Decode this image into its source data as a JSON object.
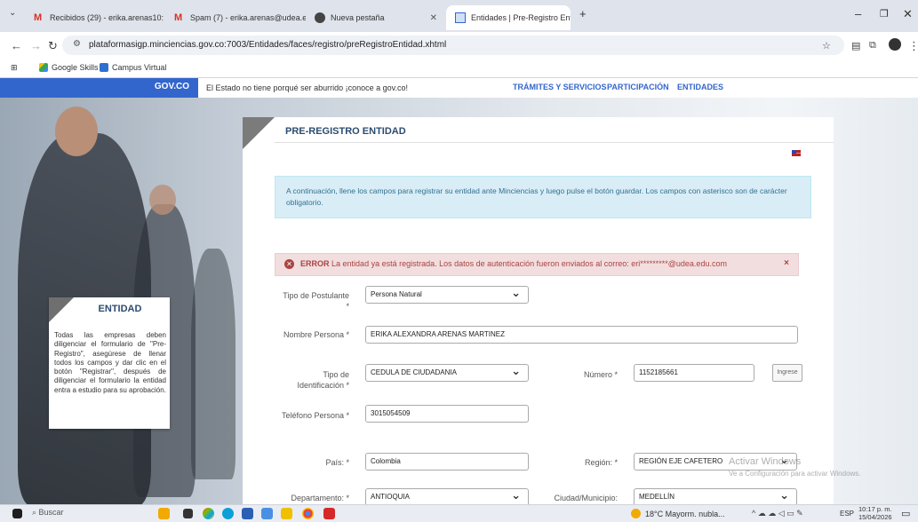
{
  "browser": {
    "tabs": [
      {
        "label": "Recibidos (29) - erika.arenas10:",
        "color": "#d93025"
      },
      {
        "label": "Spam (7) - erika.arenas@udea.e",
        "color": "#d93025"
      },
      {
        "label": "Nueva pestaña",
        "color": "#444444"
      },
      {
        "label": "Entidades | Pre-Registro Entida",
        "color": "#3366cc"
      }
    ],
    "new_tab": "+",
    "url": "plataformasigp.minciencias.gov.co:7003/Entidades/faces/registro/preRegistroEntidad.xhtml",
    "bookmarks": [
      "Google Skills",
      "Campus Virtual"
    ]
  },
  "gov": {
    "logo": "GOV.CO",
    "message": "El Estado no tiene porqué ser aburrido ¡conoce a gov.co!",
    "links": [
      "TRÁMITES Y SERVICIOS",
      "PARTICIPACIÓN",
      "ENTIDADES"
    ]
  },
  "sidebar": {
    "title": "ENTIDAD",
    "text": "Todas las empresas deben diligenciar el formulario de \"Pre-Registro\", asegúrese de llenar todos los campos y dar clic en el botón \"Registrar\", después de diligenciar el formulario la entidad entra a estudio para su aprobación."
  },
  "form": {
    "title": "PRE-REGISTRO ENTIDAD",
    "info": "A continuación, llene los campos para registrar su entidad ante Minciencias y luego pulse el botón guardar. Los campos con asterisco son de carácter obligatorio.",
    "error_label": "ERROR",
    "error_text": "La entidad ya está registrada. Los datos de autenticación fueron enviados al correo: eri*********@udea.edu.com",
    "error_close": "×",
    "tipo_postulante_label": "Tipo de Postulante *",
    "tipo_postulante": "Persona Natural",
    "nombre_label": "Nombre Persona *",
    "nombre": "ERIKA ALEXANDRA ARENAS MARTINEZ",
    "tipo_id_label": "Tipo de Identificación *",
    "tipo_id": "CEDULA DE CIUDADANIA",
    "numero_label": "Número *",
    "numero": "1152185661",
    "ingrese": "Ingrese",
    "telefono_label": "Teléfono Persona *",
    "telefono": "3015054509",
    "pais_label": "País: *",
    "pais": "Colombia",
    "region_label": "Región: *",
    "region": "REGIÓN EJE CAFETERO",
    "depto_label": "Departamento: *",
    "depto": "ANTIOQUIA",
    "ciudad_label": "Ciudad/Municipio:",
    "ciudad": "MEDELLÍN"
  },
  "watermark": {
    "line1": "Activar Windows",
    "line2": "Ve a Configuración para activar Windows."
  },
  "taskbar": {
    "search": "Buscar",
    "weather": "18°C Mayorm. nubla...",
    "lang": "ESP",
    "time": "10:17 p. m.",
    "date": "15/04/2026"
  }
}
